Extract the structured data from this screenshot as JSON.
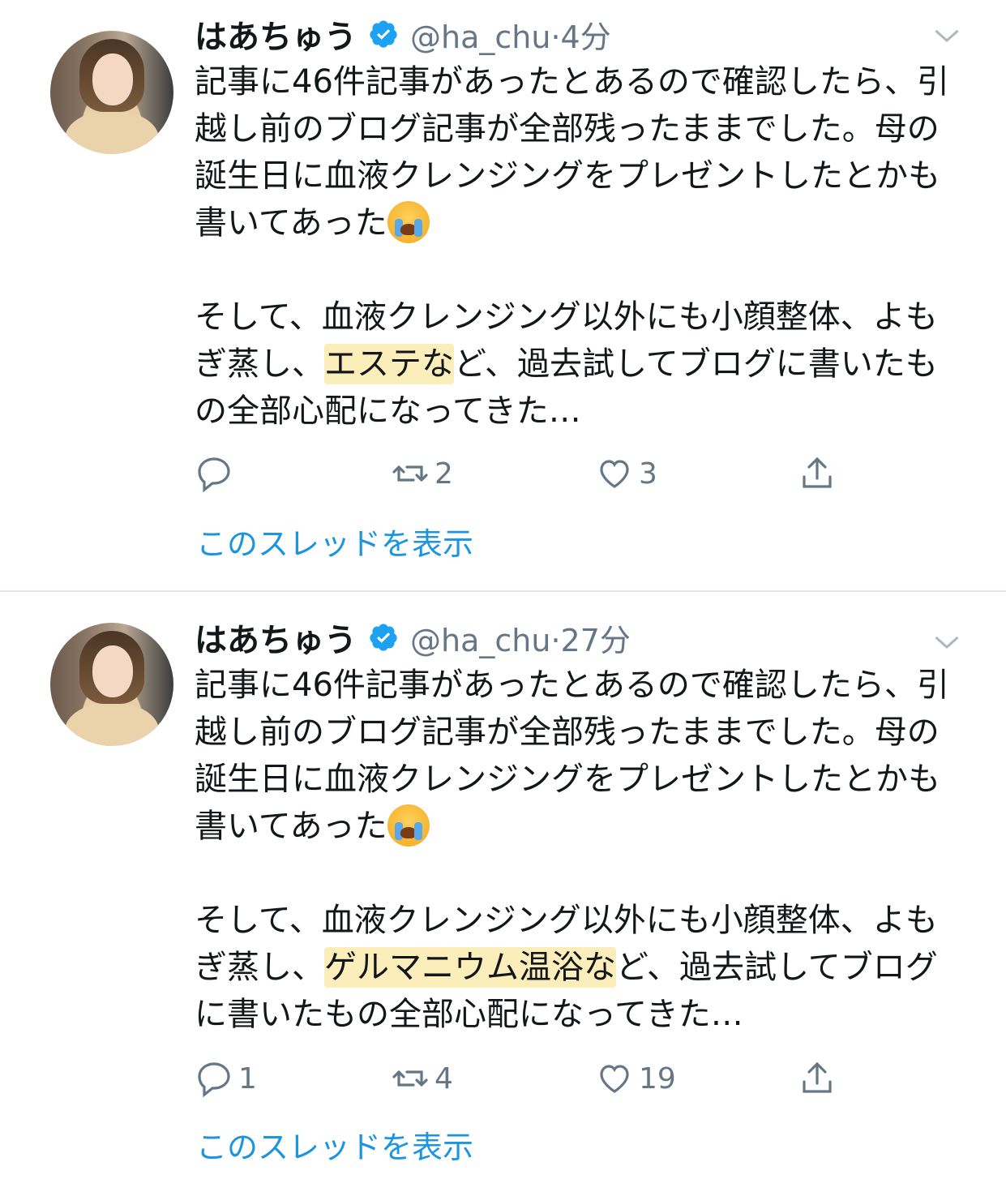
{
  "tweets": [
    {
      "name": "はあちゅう",
      "handle": "@ha_chu",
      "time": "4分",
      "text_part1": "記事に46件記事があったとあるので確認したら、引越し前のブログ記事が全部残ったままでした。母の誕生日に血液クレンジングをプレゼントしたとかも書いてあった",
      "text_part2": "\n\nそして、血液クレンジング以外にも小顔整体、よもぎ蒸し、",
      "highlight": "エステな",
      "text_part3": "ど、過去試してブログに書いたもの全部心配になってきた…",
      "counts": {
        "reply": "",
        "retweet": "2",
        "like": "3"
      },
      "thread_link": "このスレッドを表示"
    },
    {
      "name": "はあちゅう",
      "handle": "@ha_chu",
      "time": "27分",
      "text_part1": "記事に46件記事があったとあるので確認したら、引越し前のブログ記事が全部残ったままでした。母の誕生日に血液クレンジングをプレゼントしたとかも書いてあった",
      "text_part2": "\n\nそして、血液クレンジング以外にも小顔整体、よもぎ蒸し、",
      "highlight": "ゲルマニウム温浴な",
      "text_part3": "ど、過去試してブログに書いたもの全部心配になってきた…",
      "counts": {
        "reply": "1",
        "retweet": "4",
        "like": "19"
      },
      "thread_link": "このスレッドを表示"
    }
  ],
  "icons": {
    "verified": "verified-badge-icon",
    "chevron": "chevron-down-icon",
    "reply": "reply-icon",
    "retweet": "retweet-icon",
    "like": "heart-icon",
    "share": "share-icon",
    "emoji": "loudly-crying-face-emoji"
  },
  "colors": {
    "link": "#1b95e0",
    "secondary_text": "#657786",
    "highlight": "#fade78",
    "verified": "#1da1f2"
  }
}
